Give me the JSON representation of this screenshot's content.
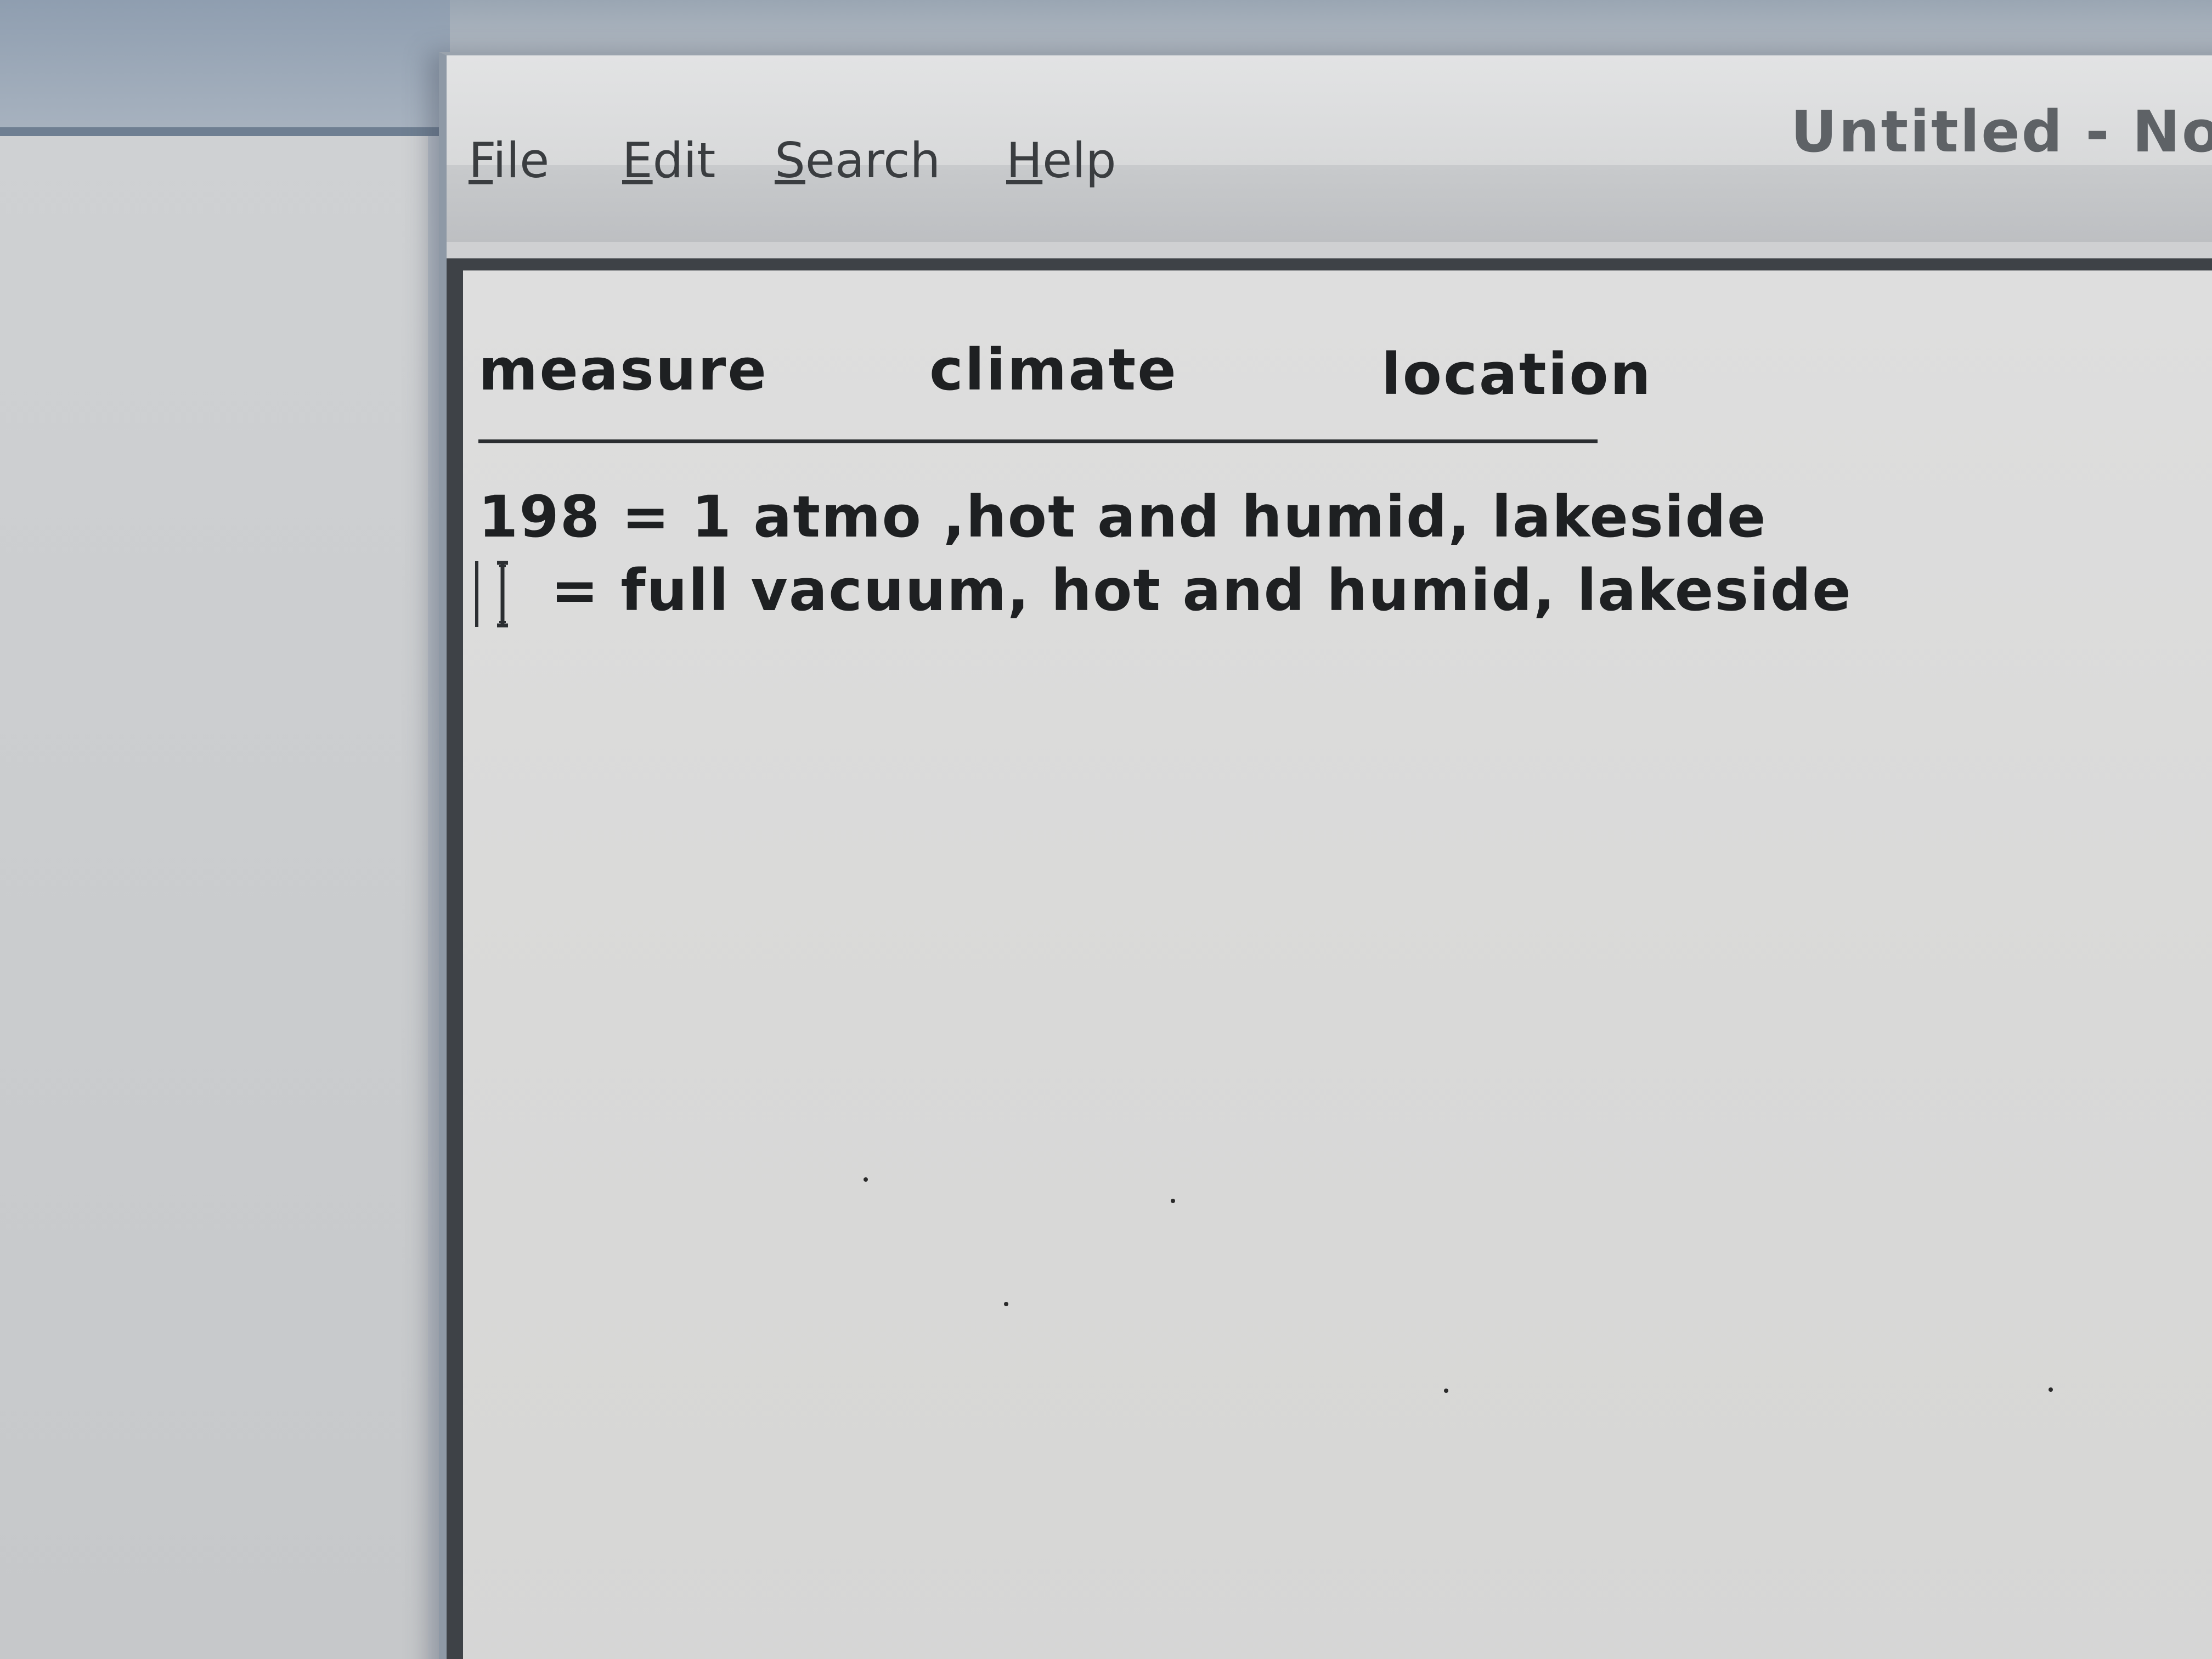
{
  "window": {
    "title": "Untitled - Not"
  },
  "menubar": {
    "items": [
      {
        "label_first": "F",
        "label_rest": "ile"
      },
      {
        "label_first": "E",
        "label_rest": "dit"
      },
      {
        "label_first": "S",
        "label_rest": "earch"
      },
      {
        "label_first": "H",
        "label_rest": "elp"
      }
    ]
  },
  "document": {
    "headers": [
      "measure",
      "climate",
      "location"
    ],
    "lines": [
      "198 = 1 atmo ,hot and humid, lakeside",
      "= full vacuum, hot and humid, lakeside"
    ]
  },
  "icons": {
    "cursor": "ibeam-cursor-icon"
  },
  "colors": {
    "title_text": "#5e6266",
    "editor_background": "#dadad9",
    "text": "#1e2022"
  }
}
